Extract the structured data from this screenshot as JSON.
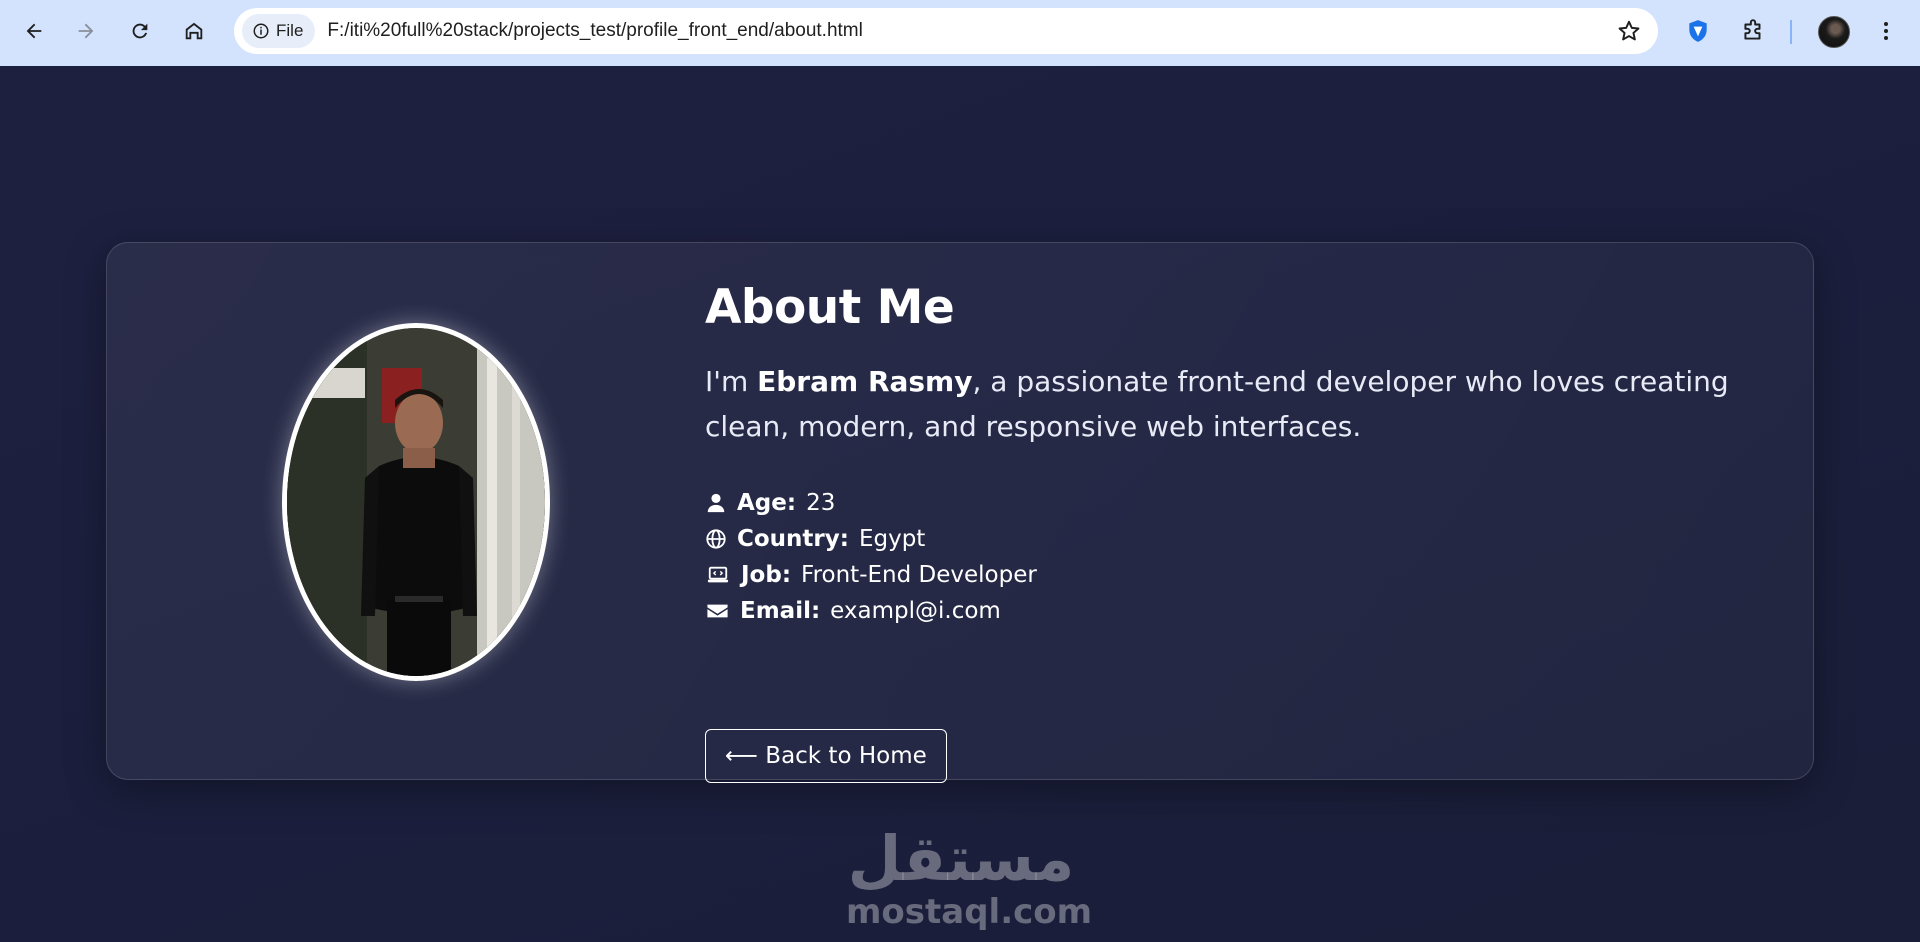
{
  "browser": {
    "chip_label": "File",
    "url": "F:/iti%20full%20stack/projects_test/profile_front_end/about.html"
  },
  "about": {
    "title": "About Me",
    "bio_prefix": "I'm ",
    "name": "Ebram Rasmy",
    "bio_suffix": ", a passionate front-end developer who loves creating clean, modern, and responsive web interfaces.",
    "facts": [
      {
        "icon": "user-icon",
        "label": "Age:",
        "value": "23"
      },
      {
        "icon": "globe-icon",
        "label": "Country:",
        "value": "Egypt"
      },
      {
        "icon": "laptop-code-icon",
        "label": "Job:",
        "value": "Front-End Developer"
      },
      {
        "icon": "envelope-icon",
        "label": "Email:",
        "value": "exampl@i.com"
      }
    ],
    "back_button": "⟵ Back to Home"
  },
  "watermark": {
    "arabic": "مستقل",
    "latin": "mostaql.com"
  },
  "colors": {
    "background": "#1b1f3a",
    "chrome": "#d3e3fd",
    "text": "#ffffff"
  }
}
